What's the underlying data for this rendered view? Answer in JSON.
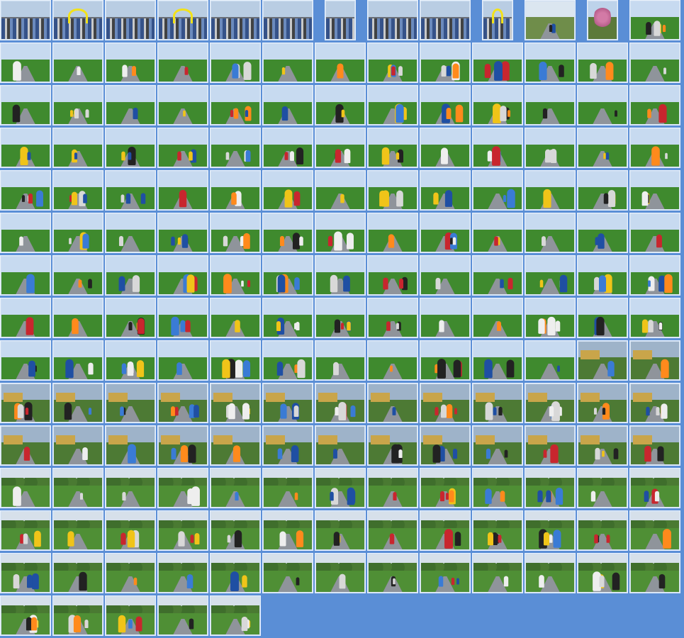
{
  "page": {
    "title": "",
    "background_color": "#5a8ed6",
    "thumbnail_border_color": "#e9f1fb"
  },
  "gallery": {
    "columns": 13,
    "rows": 15,
    "total_photos": 185,
    "palettes": {
      "countryside": {
        "sky": "#c7daf0",
        "grass": "#3f8a2e"
      },
      "village": {
        "sky": "#9eb3c9",
        "grass": "#4d7a34"
      },
      "trees": {
        "sky": "#d6e0ea",
        "grass": "#4f8f35"
      },
      "start": {
        "sky": "#b9cde3",
        "grass": "#6a6f78"
      },
      "blossom": {
        "sky": "#bdd3ea",
        "grass": "#5c7a3a"
      },
      "lone": {
        "sky": "#dbe6f0",
        "grass": "#6f8d4a"
      }
    },
    "row_scenes": [
      "start",
      "countryside",
      "countryside",
      "countryside",
      "countryside",
      "countryside",
      "countryside",
      "countryside",
      "countryside",
      "village",
      "village",
      "trees",
      "trees",
      "trees",
      "trees"
    ],
    "row_counts": [
      13,
      13,
      13,
      13,
      13,
      13,
      13,
      13,
      13,
      13,
      13,
      13,
      13,
      13,
      5
    ],
    "special_cells": [
      {
        "row": 0,
        "col": 1,
        "scene": "arch"
      },
      {
        "row": 0,
        "col": 3,
        "scene": "arch"
      },
      {
        "row": 0,
        "col": 6,
        "scene": "portrait"
      },
      {
        "row": 0,
        "col": 9,
        "scene": "arch-portrait"
      },
      {
        "row": 0,
        "col": 10,
        "scene": "lone"
      },
      {
        "row": 0,
        "col": 11,
        "scene": "blossom"
      },
      {
        "row": 0,
        "col": 12,
        "scene": "countryside"
      },
      {
        "row": 8,
        "col": 11,
        "scene": "village"
      },
      {
        "row": 8,
        "col": 12,
        "scene": "village"
      }
    ]
  }
}
